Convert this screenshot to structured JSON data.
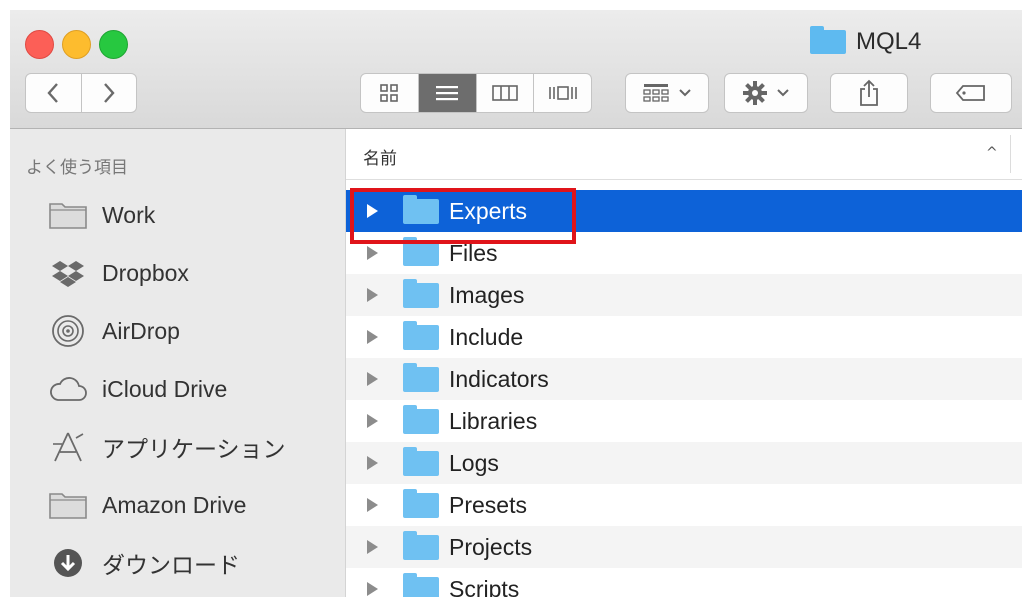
{
  "window": {
    "title": "MQL4"
  },
  "toolbar": {
    "back_icon": "chevron-left-icon",
    "forward_icon": "chevron-right-icon",
    "view_modes": [
      "icon-view",
      "list-view",
      "column-view",
      "coverflow-view"
    ],
    "selected_view": "list-view"
  },
  "sidebar": {
    "header": "よく使う項目",
    "items": [
      {
        "label": "Work",
        "icon": "folder-icon"
      },
      {
        "label": "Dropbox",
        "icon": "dropbox-icon"
      },
      {
        "label": "AirDrop",
        "icon": "airdrop-icon"
      },
      {
        "label": "iCloud Drive",
        "icon": "cloud-icon"
      },
      {
        "label": "アプリケーション",
        "icon": "applications-icon"
      },
      {
        "label": "Amazon Drive",
        "icon": "folder-icon"
      },
      {
        "label": "ダウンロード",
        "icon": "download-icon"
      }
    ]
  },
  "list": {
    "column_header": "名前",
    "sort_indicator": "^",
    "rows": [
      {
        "label": "Experts",
        "selected": true
      },
      {
        "label": "Files"
      },
      {
        "label": "Images"
      },
      {
        "label": "Include"
      },
      {
        "label": "Indicators"
      },
      {
        "label": "Libraries"
      },
      {
        "label": "Logs"
      },
      {
        "label": "Presets"
      },
      {
        "label": "Projects"
      },
      {
        "label": "Scripts"
      }
    ]
  },
  "colors": {
    "selection": "#0d62d8",
    "folder": "#6fc1f2",
    "highlight_border": "#e0141a"
  }
}
